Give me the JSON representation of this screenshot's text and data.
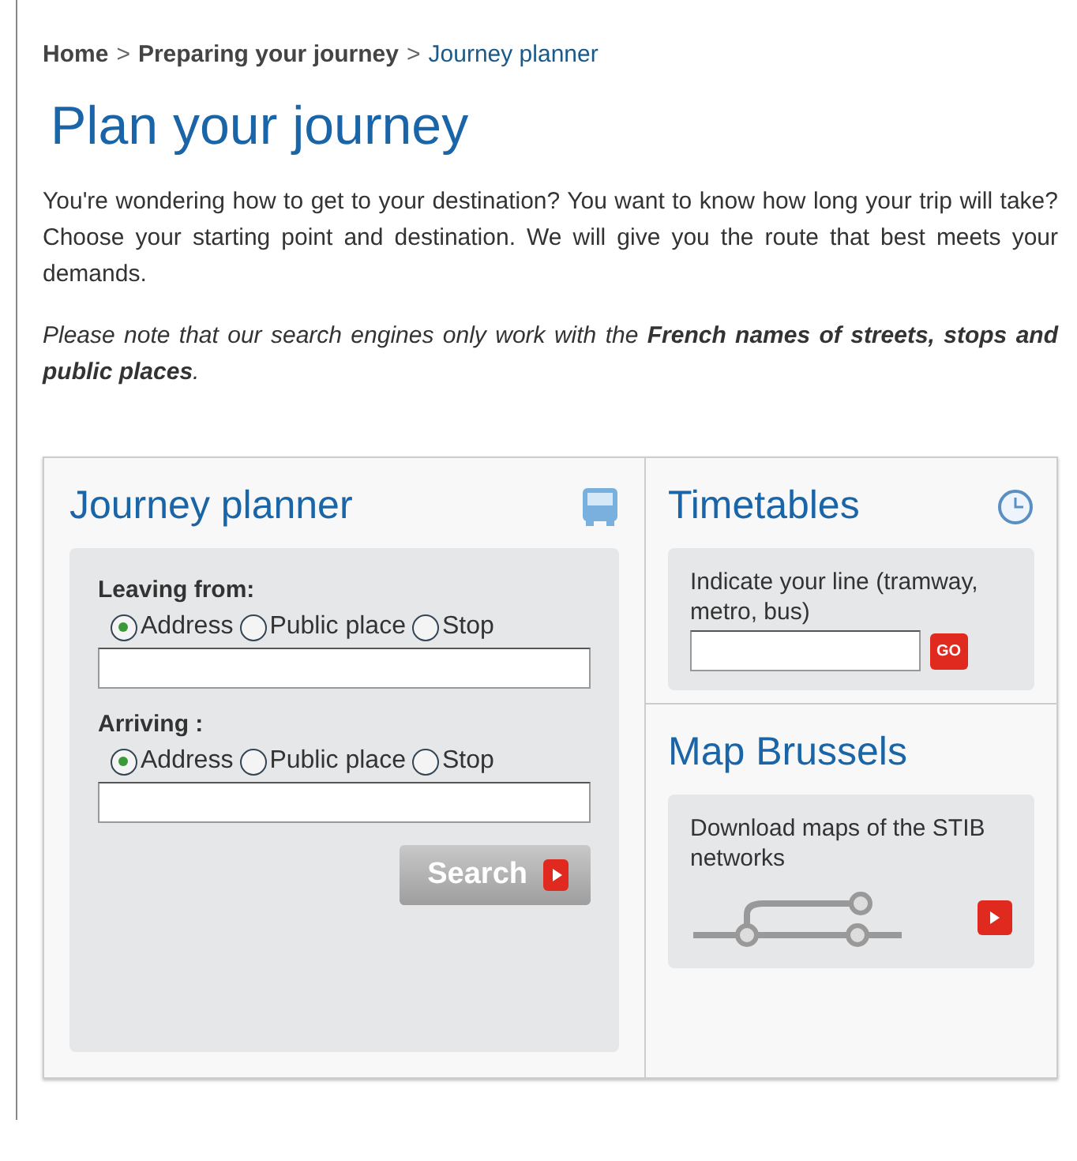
{
  "breadcrumb": [
    {
      "label": "Home",
      "kind": "link"
    },
    {
      "label": ">",
      "kind": "separator"
    },
    {
      "label": "Preparing your journey",
      "kind": "link"
    },
    {
      "label": ">",
      "kind": "separator"
    },
    {
      "label": "Journey planner",
      "kind": "current"
    }
  ],
  "title": "Plan your journey",
  "intro": "You're wondering how to get to your destination? You want to know how long your trip will take? Choose your starting point and destination. We will give you the route that best meets your demands.",
  "note": "Please note that our search engines only work with the **French names of streets, stops and public places**.",
  "planner": {
    "title": "Journey planner",
    "groups": [
      {
        "label": "Leaving from:",
        "options": [
          {
            "label": "Address",
            "selected": true
          },
          {
            "label": "Public place",
            "selected": false
          },
          {
            "label": "Stop",
            "selected": false
          }
        ]
      },
      {
        "label": "Arriving :",
        "options": [
          {
            "label": "Address",
            "selected": true
          },
          {
            "label": "Public place",
            "selected": false
          },
          {
            "label": "Stop",
            "selected": false
          }
        ]
      }
    ],
    "search_button": "Search"
  },
  "timetables": {
    "title": "Timetables",
    "prompt": "Indicate your line (tramway, metro, bus)",
    "go_button": "GO"
  },
  "map": {
    "title": "Map Brussels",
    "text": "Download maps of the STIB networks"
  }
}
